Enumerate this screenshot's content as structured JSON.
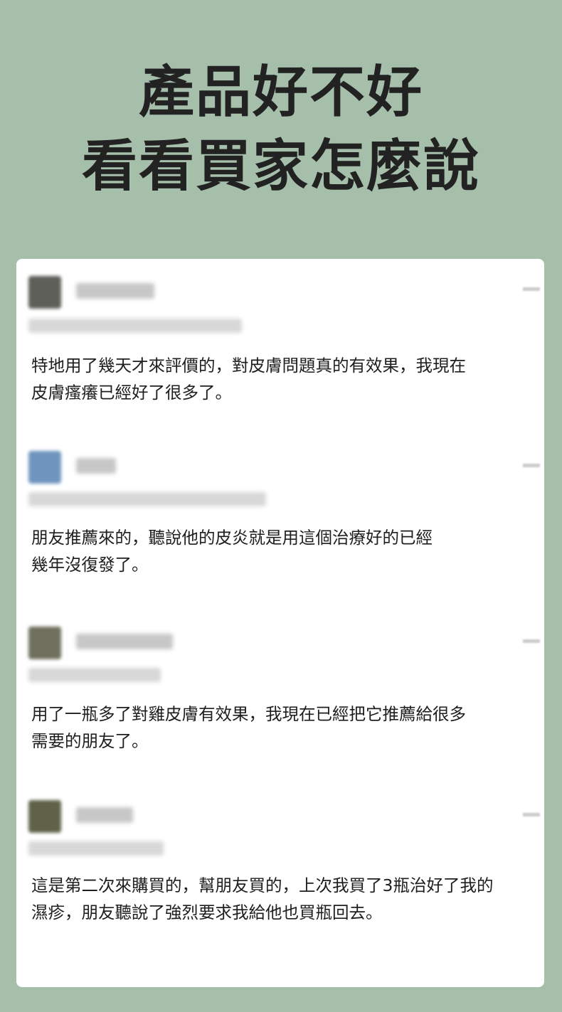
{
  "header": {
    "line1": "產品好不好",
    "line2": "看看買家怎麼說"
  },
  "reviews": [
    {
      "text": "特地用了幾天才來評價的，對皮膚問題真的有效果，我現在\n皮膚瘙癢已經好了很多了。",
      "avatar_color": "#5e5f58"
    },
    {
      "text": "朋友推薦來的，聽說他的皮炎就是用這個治療好的已經\n幾年沒復發了。",
      "avatar_color": "#6f95bf"
    },
    {
      "text": "用了一瓶多了對雞皮膚有效果，我現在已經把它推薦給很多\n需要的朋友了。",
      "avatar_color": "#70705f"
    },
    {
      "text": "這是第二次來購買的，幫朋友買的，上次我買了3瓶治好了我的\n濕疹，朋友聽說了強烈要求我給他也買瓶回去。",
      "avatar_color": "#5f6248"
    }
  ]
}
